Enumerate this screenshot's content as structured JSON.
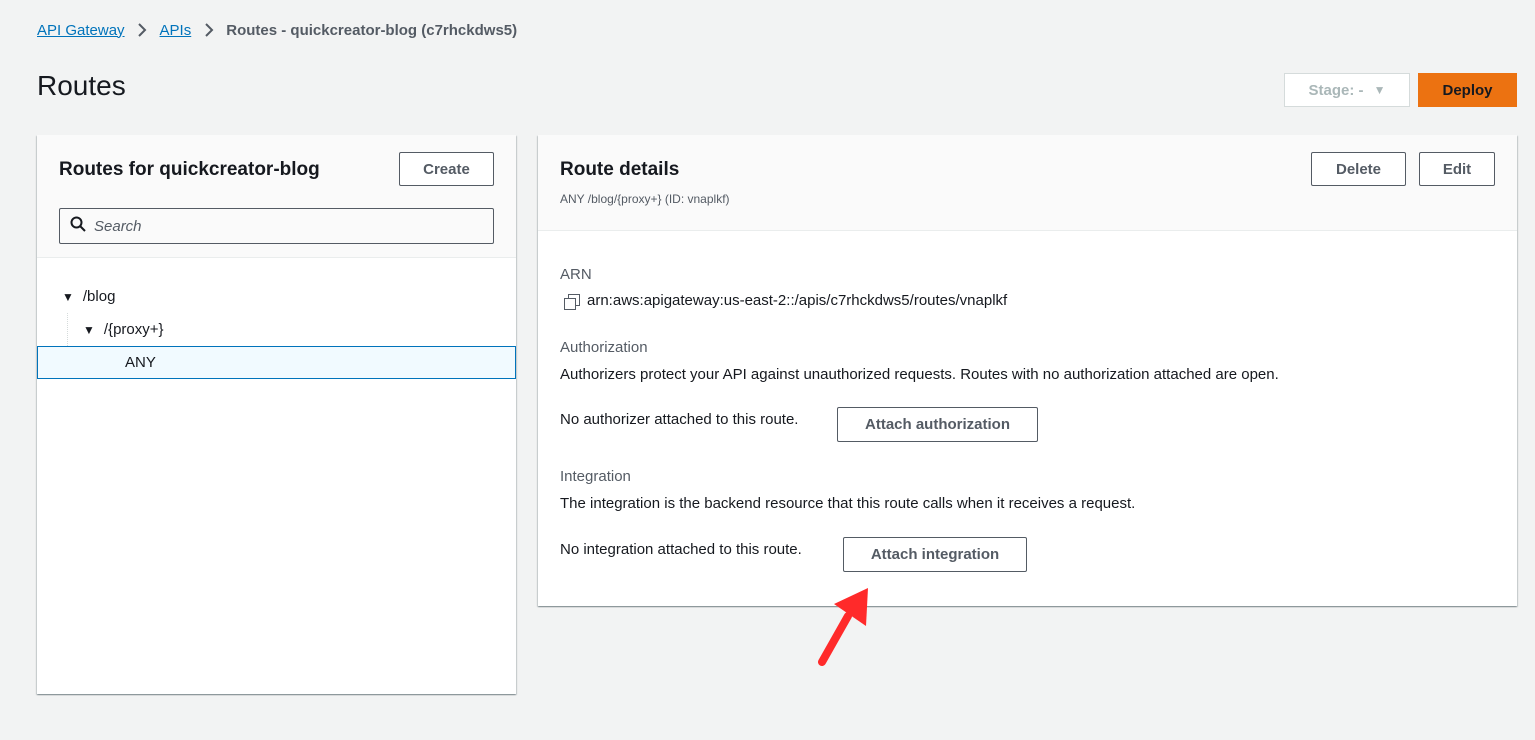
{
  "breadcrumb": {
    "items": [
      "API Gateway",
      "APIs"
    ],
    "current": "Routes - quickcreator-blog (c7rhckdws5)"
  },
  "page_title": "Routes",
  "stage": {
    "label": "Stage: -"
  },
  "deploy_label": "Deploy",
  "routes_panel": {
    "title": "Routes for quickcreator-blog",
    "create_label": "Create",
    "search_placeholder": "Search",
    "tree": {
      "level1": "/blog",
      "level2": "/{proxy+}",
      "method": "ANY"
    }
  },
  "details_panel": {
    "title": "Route details",
    "subtitle": "ANY /blog/{proxy+} (ID: vnaplkf)",
    "delete_label": "Delete",
    "edit_label": "Edit",
    "arn_label": "ARN",
    "arn_value": "arn:aws:apigateway:us-east-2::/apis/c7rhckdws5/routes/vnaplkf",
    "authorization_label": "Authorization",
    "authorization_desc": "Authorizers protect your API against unauthorized requests. Routes with no authorization attached are open.",
    "authorization_status": "No authorizer attached to this route.",
    "attach_authorization_label": "Attach authorization",
    "integration_label": "Integration",
    "integration_desc": "The integration is the backend resource that this route calls when it receives a request.",
    "integration_status": "No integration attached to this route.",
    "attach_integration_label": "Attach integration"
  },
  "colors": {
    "accent": "#ec7211",
    "link": "#0073bb",
    "annotation_arrow": "#ff2a2a"
  }
}
